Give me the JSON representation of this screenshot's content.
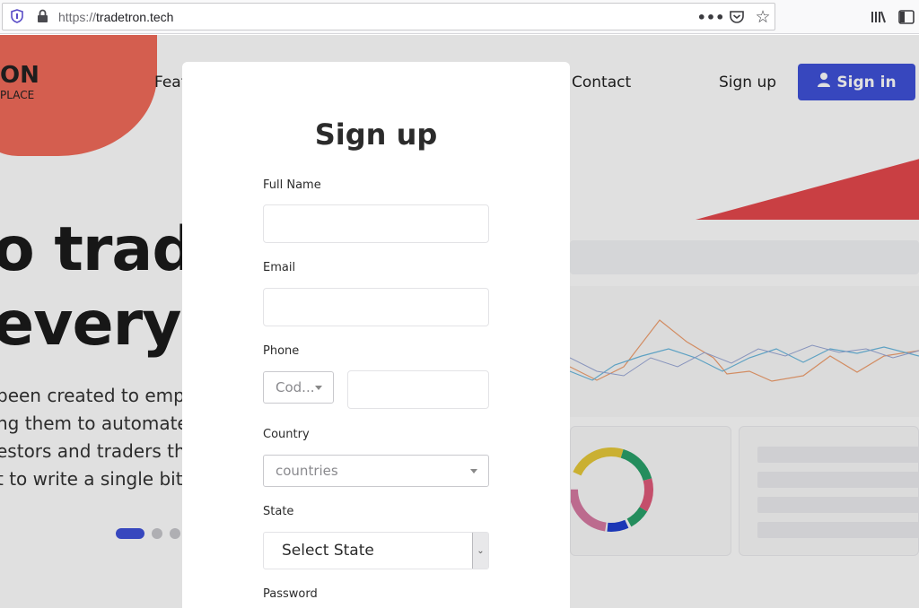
{
  "browser": {
    "url_protocol": "https://",
    "url_host": "tradetron.tech"
  },
  "site": {
    "logo_top": "ON",
    "logo_bottom": "PLACE",
    "nav": {
      "features": "Feat",
      "contact": "Contact",
      "signup": "Sign up",
      "signin": "Sign in"
    },
    "hero": {
      "line1": "o trad",
      "line2": "everyo",
      "para1": "been created to emp",
      "para2": "ng them to automate",
      "para3": "estors and traders th",
      "para4": "t to write a single bit o"
    }
  },
  "modal": {
    "title": "Sign up",
    "full_name_label": "Full Name",
    "email_label": "Email",
    "phone_label": "Phone",
    "phone_code_placeholder": "Cod...",
    "country_label": "Country",
    "country_placeholder": "countries",
    "state_label": "State",
    "state_placeholder": "Select State",
    "password_label": "Password"
  },
  "colors": {
    "accent": "#3f51d9",
    "blob": "#f26b5a",
    "wedge": "#e5484d"
  }
}
